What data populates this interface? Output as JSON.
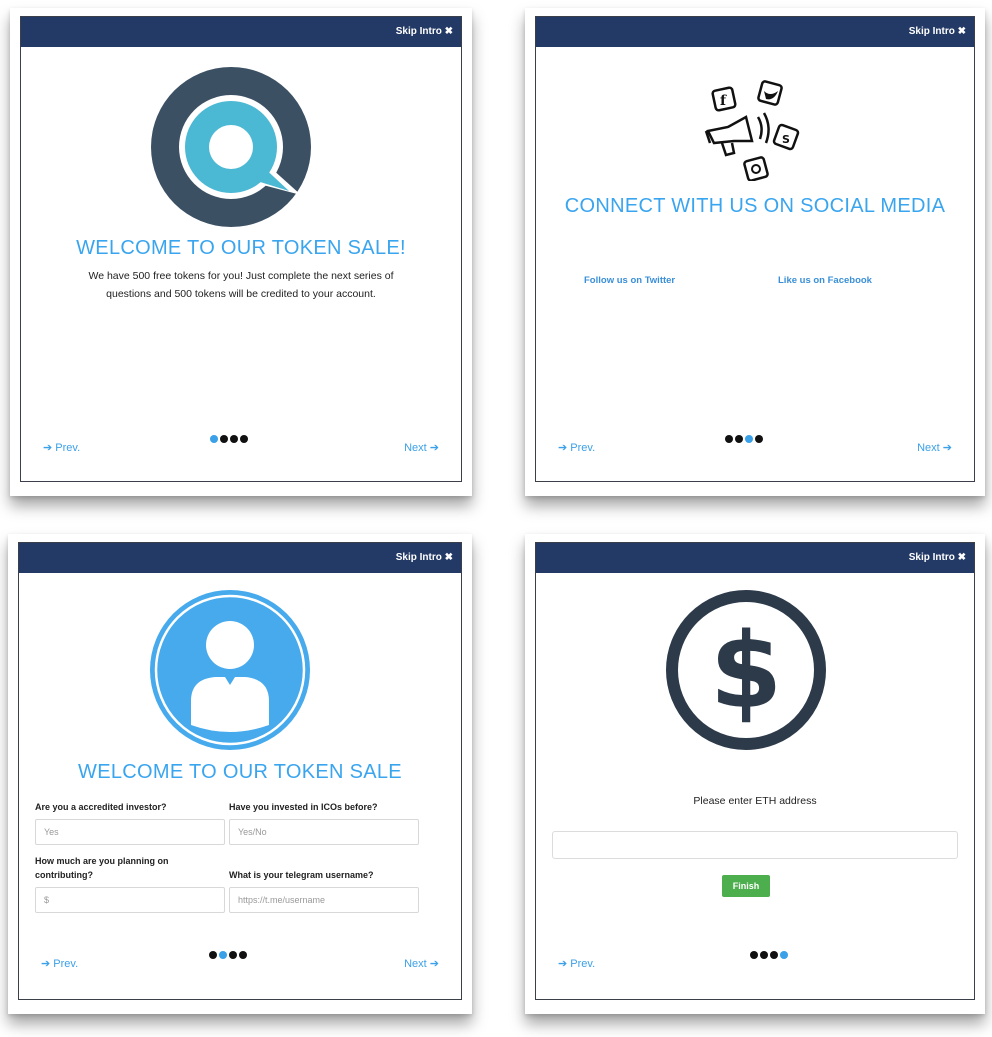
{
  "colors": {
    "header_bar": "#243a66",
    "accent_blue": "#3aa5ef",
    "icon_dark": "#2d3a4a",
    "finish_green": "#4cae4c"
  },
  "common": {
    "skip_label": "Skip Intro ✖",
    "prev_label": "➔ Prev.",
    "next_label": "Next ➔"
  },
  "panel1": {
    "icon": "chat-search-logo-icon",
    "heading": "WELCOME TO OUR TOKEN SALE!",
    "text_line1": "We have 500 free tokens for you! Just complete the next series of",
    "text_line2": "questions and 500 tokens will be credited to your account.",
    "active_step": 1
  },
  "panel2": {
    "icon": "social-megaphone-icon",
    "heading": "CONNECT WITH US ON SOCIAL MEDIA",
    "twitter_link": "Follow us on Twitter",
    "facebook_link": "Like us on Facebook",
    "active_step": 3
  },
  "panel3": {
    "icon": "user-avatar-icon",
    "heading": "WELCOME TO OUR TOKEN SALE",
    "q1_label": "Are you a accredited investor?",
    "q1_placeholder": "Yes",
    "q2_label": "Have you invested in ICOs before?",
    "q2_placeholder": "Yes/No",
    "q3_label_line1": "How much are you planning on",
    "q3_label_line2": "contributing?",
    "q3_placeholder": "$",
    "q4_label": "What is your telegram username?",
    "q4_placeholder": "https://t.me/username",
    "active_step": 2
  },
  "panel4": {
    "icon": "dollar-coin-icon",
    "prompt": "Please enter ETH address",
    "finish_label": "Finish",
    "active_step": 4
  }
}
